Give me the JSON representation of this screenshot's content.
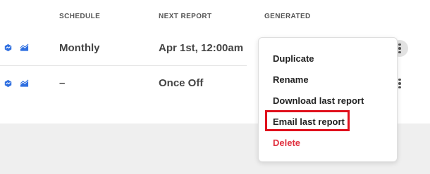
{
  "table": {
    "headers": {
      "schedule": "SCHEDULE",
      "next_report": "NEXT REPORT",
      "generated": "GENERATED"
    },
    "rows": [
      {
        "schedule": "Monthly",
        "next_report": "Apr 1st, 12:00am",
        "icons": [
          "metric-icon",
          "area-chart-icon"
        ]
      },
      {
        "schedule": "–",
        "next_report": "Once Off",
        "icons": [
          "metric-icon",
          "area-chart-icon"
        ]
      }
    ]
  },
  "context_menu": {
    "items": [
      "Duplicate",
      "Rename",
      "Download last report",
      "Email last report",
      "Delete"
    ],
    "highlighted_item": "Email last report"
  },
  "colors": {
    "accent": "#2f6fe0",
    "danger": "#e0303f",
    "highlight": "#e0101c"
  }
}
